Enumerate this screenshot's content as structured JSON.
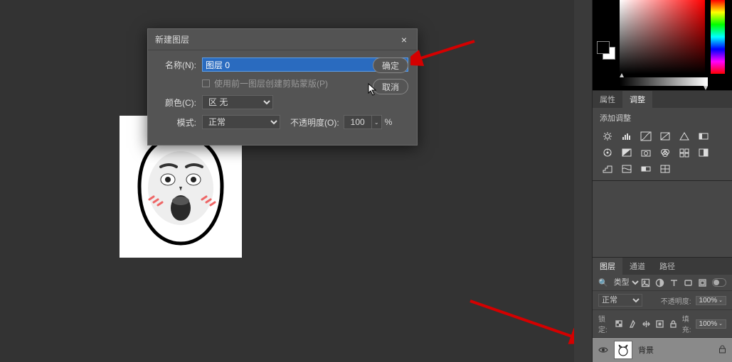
{
  "dialog": {
    "title": "新建图层",
    "name_label": "名称(N):",
    "name_value": "图层 0",
    "clip_mask_label": "使用前一图层创建剪贴蒙版(P)",
    "color_label": "颜色(C):",
    "color_value": "区 无",
    "mode_label": "模式:",
    "mode_value": "正常",
    "opacity_label": "不透明度(O):",
    "opacity_value": "100",
    "percent": "%",
    "ok_label": "确定",
    "cancel_label": "取消"
  },
  "panels": {
    "properties_tab": "属性",
    "adjustments_tab": "调整",
    "add_adjustment": "添加调整",
    "layers_tab": "图层",
    "channels_tab": "通道",
    "paths_tab": "路径",
    "kind_label": "类型",
    "blend_mode": "正常",
    "opacity_label": "不透明度:",
    "opacity_value": "100%",
    "lock_label": "锁定:",
    "fill_label": "填充:",
    "fill_value": "100%",
    "layer": {
      "name": "背景"
    }
  }
}
